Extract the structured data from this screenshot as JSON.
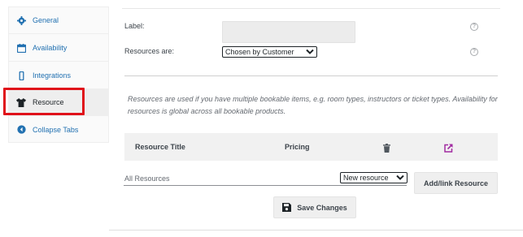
{
  "sidebar": {
    "items": [
      {
        "label": "General",
        "icon": "gear-icon"
      },
      {
        "label": "Availability",
        "icon": "calendar-icon"
      },
      {
        "label": "Integrations",
        "icon": "mobile-icon"
      },
      {
        "label": "Resource",
        "icon": "shirt-icon",
        "active": true
      },
      {
        "label": "Collapse Tabs",
        "icon": "collapse-left-icon"
      }
    ],
    "highlight_color": "#e0111a"
  },
  "form": {
    "label_label": "Label:",
    "label_value": "",
    "resources_are_label": "Resources are:",
    "resources_are_selected": "Chosen by Customer",
    "help_glyph": "?"
  },
  "description": "Resources are used if you have multiple bookable items, e.g. room types, instructors or ticket types. Availability for resources is global across all bookable products.",
  "table": {
    "headers": [
      "Resource Title",
      "Pricing"
    ],
    "header_icons": [
      "trash-icon",
      "external-link-icon"
    ]
  },
  "add_resource": {
    "field_label": "All Resources",
    "select_selected": "New resource",
    "button_label": "Add/link Resource"
  },
  "save_button_label": "Save Changes",
  "colors": {
    "link": "#2271b1",
    "trash": "#50575e",
    "external_link": "#a12aa1",
    "highlight": "#e0111a"
  }
}
